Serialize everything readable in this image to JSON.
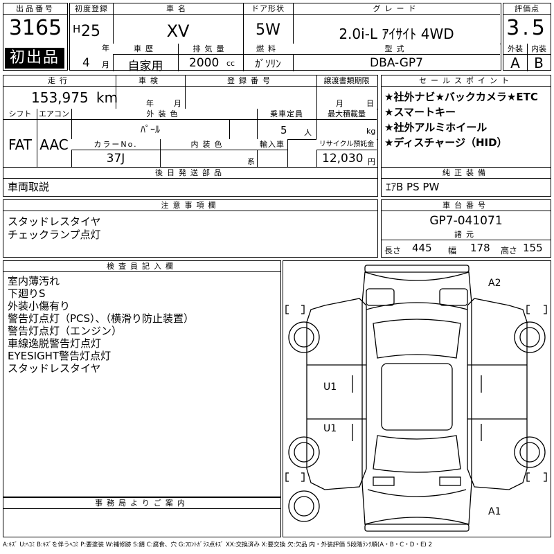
{
  "lot": {
    "label": "出品番号",
    "number": "3165",
    "badge": "初出品"
  },
  "first_reg": {
    "label": "初度登録",
    "era": "H",
    "year": "25",
    "year_unit": "年",
    "month": "4",
    "month_unit": "月"
  },
  "car_name": {
    "label": "車名",
    "value": "XV"
  },
  "history": {
    "label": "車歴",
    "value": "自家用"
  },
  "displacement": {
    "label": "排気量",
    "value": "2000",
    "unit": "cc"
  },
  "door": {
    "label": "ドア形状",
    "value": "5W"
  },
  "fuel": {
    "label": "燃料",
    "value": "ｶﾞｿﾘﾝ"
  },
  "grade": {
    "label": "グレード",
    "value": "2.0i-L ｱｲｻｲﾄ 4WD"
  },
  "model": {
    "label": "型式",
    "value": "DBA-GP7"
  },
  "score": {
    "label": "評価点",
    "value": "3.5",
    "ext_label": "外装",
    "ext_value": "A",
    "int_label": "内装",
    "int_value": "B"
  },
  "mileage": {
    "label": "走行",
    "value": "153,975",
    "unit": "km"
  },
  "inspection": {
    "label": "車検",
    "year_unit": "年",
    "month_unit": "月"
  },
  "reg_no": {
    "label": "登録番号"
  },
  "transfer_docs": {
    "label": "譲渡書類期限",
    "month_unit": "月",
    "day_unit": "日"
  },
  "shift": {
    "label": "シフト",
    "value": "FAT"
  },
  "aircon": {
    "label": "エアコン",
    "value": "AAC"
  },
  "ext_color": {
    "label": "外装色",
    "value": "ﾊﾟｰﾙ"
  },
  "capacity": {
    "label": "乗車定員",
    "value": "5",
    "unit": "人"
  },
  "max_load": {
    "label": "最大積載量",
    "unit": "kg"
  },
  "color_no": {
    "label": "カラーNo.",
    "value": "37J"
  },
  "int_color": {
    "label": "内装色",
    "unit": "系"
  },
  "import": {
    "label": "輸入車"
  },
  "recycle": {
    "label": "リサイクル預託金",
    "value": "12,030",
    "unit": "円"
  },
  "sales_points": {
    "label": "セールスポイント",
    "lines": [
      "★社外ナビ★バックカメラ★ETC",
      "★スマートキー",
      "★社外アルミホイール",
      "★ディスチャージ（HID）"
    ]
  },
  "later_parts": {
    "label": "後日発送部品",
    "value": "車両取説"
  },
  "genuine": {
    "label": "純正装備",
    "value": "ｴｱB PS PW"
  },
  "cautions": {
    "label": "注意事項欄",
    "lines": [
      "スタッドレスタイヤ",
      "チェックランプ点灯"
    ]
  },
  "chassis": {
    "label": "車台番号",
    "value": "GP7-041071"
  },
  "specs": {
    "label": "諸元",
    "length_label": "長さ",
    "length": "445",
    "width_label": "幅",
    "width": "178",
    "height_label": "高さ",
    "height": "155"
  },
  "inspector": {
    "label": "検査員記入欄",
    "lines": [
      "室内薄汚れ",
      "下廻りS",
      "外装小傷有り",
      "警告灯点灯（PCS）、（横滑り防止装置）",
      "警告灯点灯（エンジン）",
      "車線逸脱警告灯点灯",
      "EYESIGHT警告灯点灯",
      "スタッドレスタイヤ"
    ]
  },
  "office": {
    "label": "事務局よりご案内"
  },
  "diagram": {
    "marks": [
      "A2",
      "U1",
      "U1",
      "A1"
    ]
  },
  "legend": "A:ｷｽﾞ U:ﾍｺﾐ B:ｷｽﾞを伴うﾍｺﾐ P:要塗装 W:補修跡 S:錆 C:腐食、穴 G:ﾌﾛﾝﾄｶﾞﾗｽ点ｷｽﾞ XX:交換済み X:要交換 欠:欠品 内・外装評価 5段階ﾗﾝｸ順(A・B・C・D・E) 2"
}
